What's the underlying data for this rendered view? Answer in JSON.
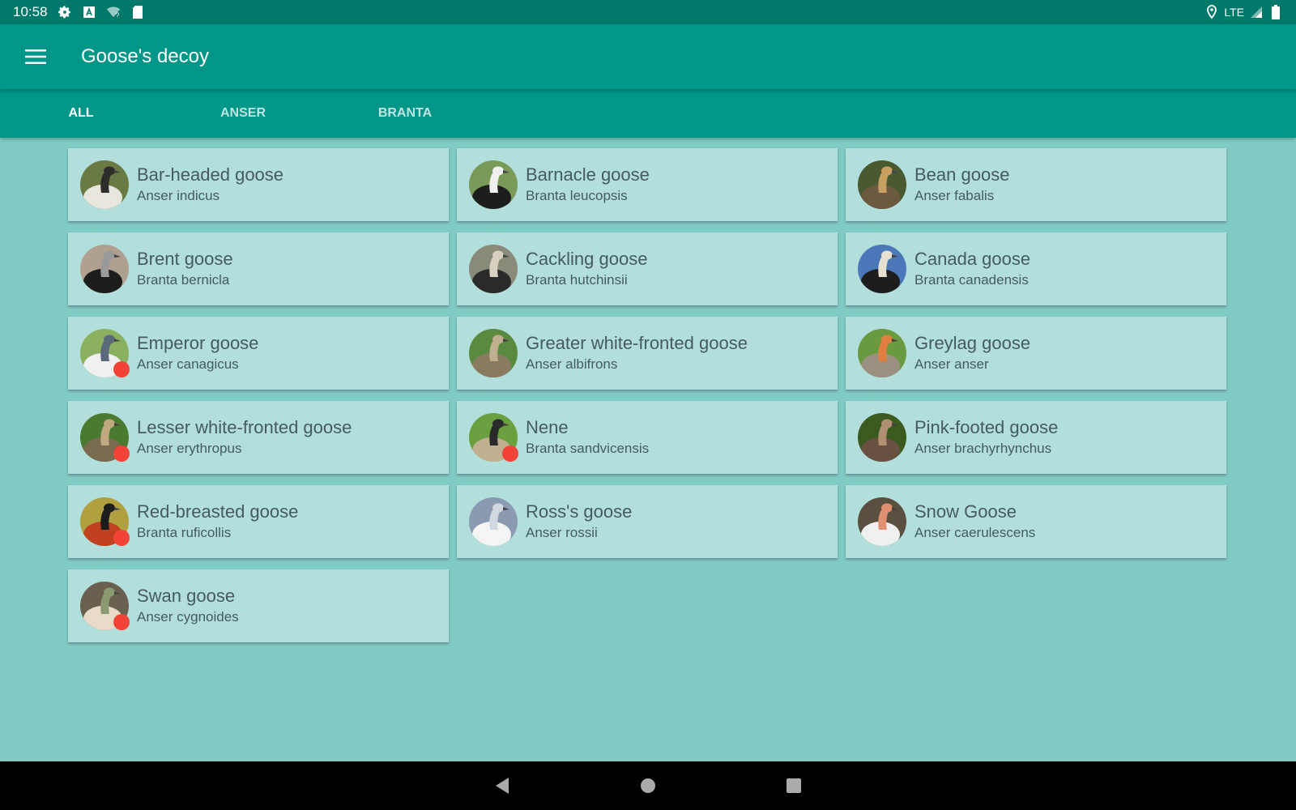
{
  "status_bar": {
    "time": "10:58",
    "network": "LTE",
    "icons": [
      "gear-icon",
      "a-box-icon",
      "wifi-question-icon",
      "sd-card-icon",
      "location-icon",
      "signal-icon",
      "battery-icon"
    ]
  },
  "app_bar": {
    "title": "Goose's decoy",
    "menu_icon": "hamburger-menu-icon"
  },
  "tabs": [
    {
      "label": "ALL",
      "active": true
    },
    {
      "label": "ANSER",
      "active": false
    },
    {
      "label": "BRANTA",
      "active": false
    }
  ],
  "geese": [
    {
      "common": "Bar-headed goose",
      "latin": "Anser indicus",
      "badge": false,
      "colors": [
        "#6a7a45",
        "#e8e6dc",
        "#2d2d2d"
      ]
    },
    {
      "common": "Barnacle goose",
      "latin": "Branta leucopsis",
      "badge": false,
      "colors": [
        "#7a9a5a",
        "#1d1d1d",
        "#f0f0f0"
      ]
    },
    {
      "common": "Bean goose",
      "latin": "Anser fabalis",
      "badge": false,
      "colors": [
        "#4a5a30",
        "#6b5a40",
        "#c8a060"
      ]
    },
    {
      "common": "Brent goose",
      "latin": "Branta bernicla",
      "badge": false,
      "colors": [
        "#b0a090",
        "#1d1d1d",
        "#9a9a9a"
      ]
    },
    {
      "common": "Cackling goose",
      "latin": "Branta hutchinsii",
      "badge": false,
      "colors": [
        "#8a8a7a",
        "#2a2a2a",
        "#d8d0c0"
      ]
    },
    {
      "common": "Canada goose",
      "latin": "Branta canadensis",
      "badge": false,
      "colors": [
        "#4a78b8",
        "#1d1d1d",
        "#e8e0d0"
      ]
    },
    {
      "common": "Emperor goose",
      "latin": "Anser canagicus",
      "badge": true,
      "colors": [
        "#8ab060",
        "#f0f0f0",
        "#5a6a7a"
      ]
    },
    {
      "common": "Greater white-fronted goose",
      "latin": "Anser albifrons",
      "badge": false,
      "colors": [
        "#5a8a40",
        "#8a7a60",
        "#c0b090"
      ]
    },
    {
      "common": "Greylag goose",
      "latin": "Anser anser",
      "badge": false,
      "colors": [
        "#6a9a40",
        "#9a9080",
        "#e08040"
      ]
    },
    {
      "common": "Lesser white-fronted goose",
      "latin": "Anser erythropus",
      "badge": true,
      "colors": [
        "#4a7a30",
        "#7a6a50",
        "#c0a880"
      ]
    },
    {
      "common": "Nene",
      "latin": "Branta sandvicensis",
      "badge": true,
      "colors": [
        "#6aa040",
        "#c0b090",
        "#2a2a2a"
      ]
    },
    {
      "common": "Pink-footed goose",
      "latin": "Anser brachyrhynchus",
      "badge": false,
      "colors": [
        "#3a5a20",
        "#6a5040",
        "#b09070"
      ]
    },
    {
      "common": "Red-breasted goose",
      "latin": "Branta ruficollis",
      "badge": true,
      "colors": [
        "#b0a040",
        "#c04020",
        "#1d1d1d"
      ]
    },
    {
      "common": "Ross's goose",
      "latin": "Anser rossii",
      "badge": false,
      "colors": [
        "#8a9ab0",
        "#f4f4f4",
        "#d0d8e0"
      ]
    },
    {
      "common": "Snow Goose",
      "latin": "Anser caerulescens",
      "badge": false,
      "colors": [
        "#5a5040",
        "#f0f0f0",
        "#e09070"
      ]
    },
    {
      "common": "Swan goose",
      "latin": "Anser cygnoides",
      "badge": true,
      "colors": [
        "#6a6050",
        "#e8dcc8",
        "#8a9a70"
      ]
    }
  ],
  "colors": {
    "primary": "#009688",
    "primary_dark": "#00796b",
    "background": "#80cbc4",
    "card": "#b2dfdb",
    "badge": "#f44336",
    "text": "#455a64"
  },
  "nav_bar": {
    "icons": [
      "back-triangle-icon",
      "home-circle-icon",
      "recents-square-icon"
    ]
  }
}
